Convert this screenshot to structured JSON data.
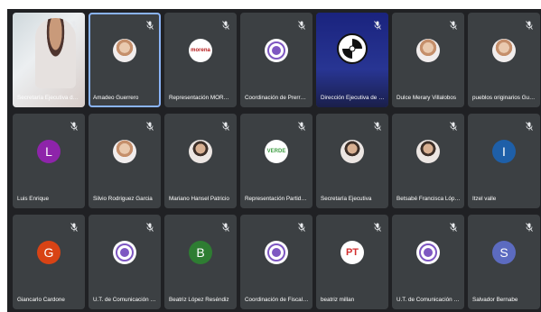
{
  "participants": [
    {
      "name": "Secretaría Ejecutiva de ...",
      "type": "video"
    },
    {
      "name": "Amadeo Guerrero",
      "type": "photo",
      "active": true
    },
    {
      "name": "Representación MORENA",
      "type": "logo",
      "logo_text": "morena",
      "color": "#b71c1c"
    },
    {
      "name": "Coordinación de Prerrog...",
      "type": "logo",
      "logo_text": "",
      "color": "#7e57c2"
    },
    {
      "name": "Dirección Ejecutiva de Pr...",
      "type": "presentation"
    },
    {
      "name": "Dulce Merary Villalobos",
      "type": "photo"
    },
    {
      "name": "pueblos originarios Guerr...",
      "type": "photo"
    },
    {
      "name": "Luis Enrique",
      "type": "letter",
      "letter": "L",
      "color": "#8e24aa"
    },
    {
      "name": "Silvio Rodriguez Garcia",
      "type": "photo"
    },
    {
      "name": "Mariano Hansel Patricio",
      "type": "photo2"
    },
    {
      "name": "Representación Partido V...",
      "type": "logo",
      "logo_text": "VERDE",
      "color": "#43a047"
    },
    {
      "name": "Secretaría Ejecutiva",
      "type": "photo2"
    },
    {
      "name": "Betsabé Francisca López ...",
      "type": "photo2"
    },
    {
      "name": "Itzel valle",
      "type": "letter",
      "letter": "I",
      "color": "#1e5fa8"
    },
    {
      "name": "Giancarlo Cardone",
      "type": "letter",
      "letter": "G",
      "color": "#d84315"
    },
    {
      "name": "U.T. de Comunicación Soc...",
      "type": "logo",
      "logo_text": "",
      "color": "#7e57c2"
    },
    {
      "name": "Beatriz López Reséndiz",
      "type": "letter",
      "letter": "B",
      "color": "#2e7d32"
    },
    {
      "name": "Coordinación de Fiscaliza...",
      "type": "logo",
      "logo_text": "",
      "color": "#7e57c2"
    },
    {
      "name": "beatriz millan",
      "type": "logo",
      "logo_text": "PT",
      "color": "#d32f2f"
    },
    {
      "name": "U.T. de Comunicación Soc...",
      "type": "logo",
      "logo_text": "",
      "color": "#7e57c2"
    },
    {
      "name": "Salvador Bernabe",
      "type": "letter",
      "letter": "S",
      "color": "#5c6bc0"
    }
  ]
}
